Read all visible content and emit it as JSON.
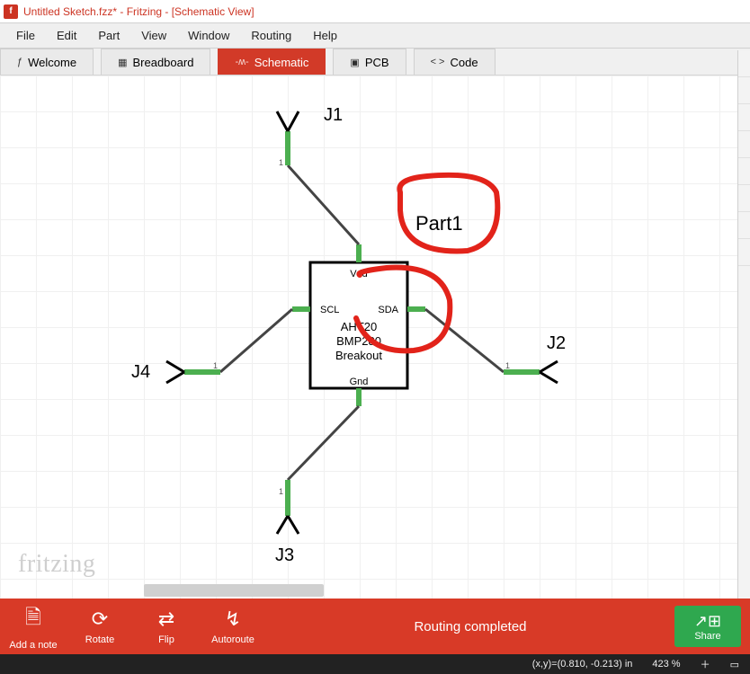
{
  "title": "Untitled Sketch.fzz* - Fritzing - [Schematic View]",
  "menu": {
    "file": "File",
    "edit": "Edit",
    "part": "Part",
    "view": "View",
    "window": "Window",
    "routing": "Routing",
    "help": "Help"
  },
  "tabs": {
    "welcome": "Welcome",
    "breadboard": "Breadboard",
    "schematic": "Schematic",
    "pcb": "PCB",
    "code": "Code"
  },
  "schematic": {
    "part_label": "Part1",
    "component": {
      "top_pin": "Vdd",
      "left_pin": "SCL",
      "right_pin": "SDA",
      "bot_pin": "Gnd",
      "line1": "AHT20",
      "line2": "BMP280",
      "line3": "Breakout"
    },
    "j1": "J1",
    "j2": "J2",
    "j3": "J3",
    "j4": "J4",
    "pin_small": "1"
  },
  "watermark": "fritzing",
  "toolbar": {
    "addnote": "Add a note",
    "rotate": "Rotate",
    "flip": "Flip",
    "autoroute": "Autoroute",
    "routing_msg": "Routing completed",
    "share": "Share"
  },
  "status": {
    "coords": "(x,y)=(0.810, -0.213) in",
    "zoom": "423 %"
  }
}
